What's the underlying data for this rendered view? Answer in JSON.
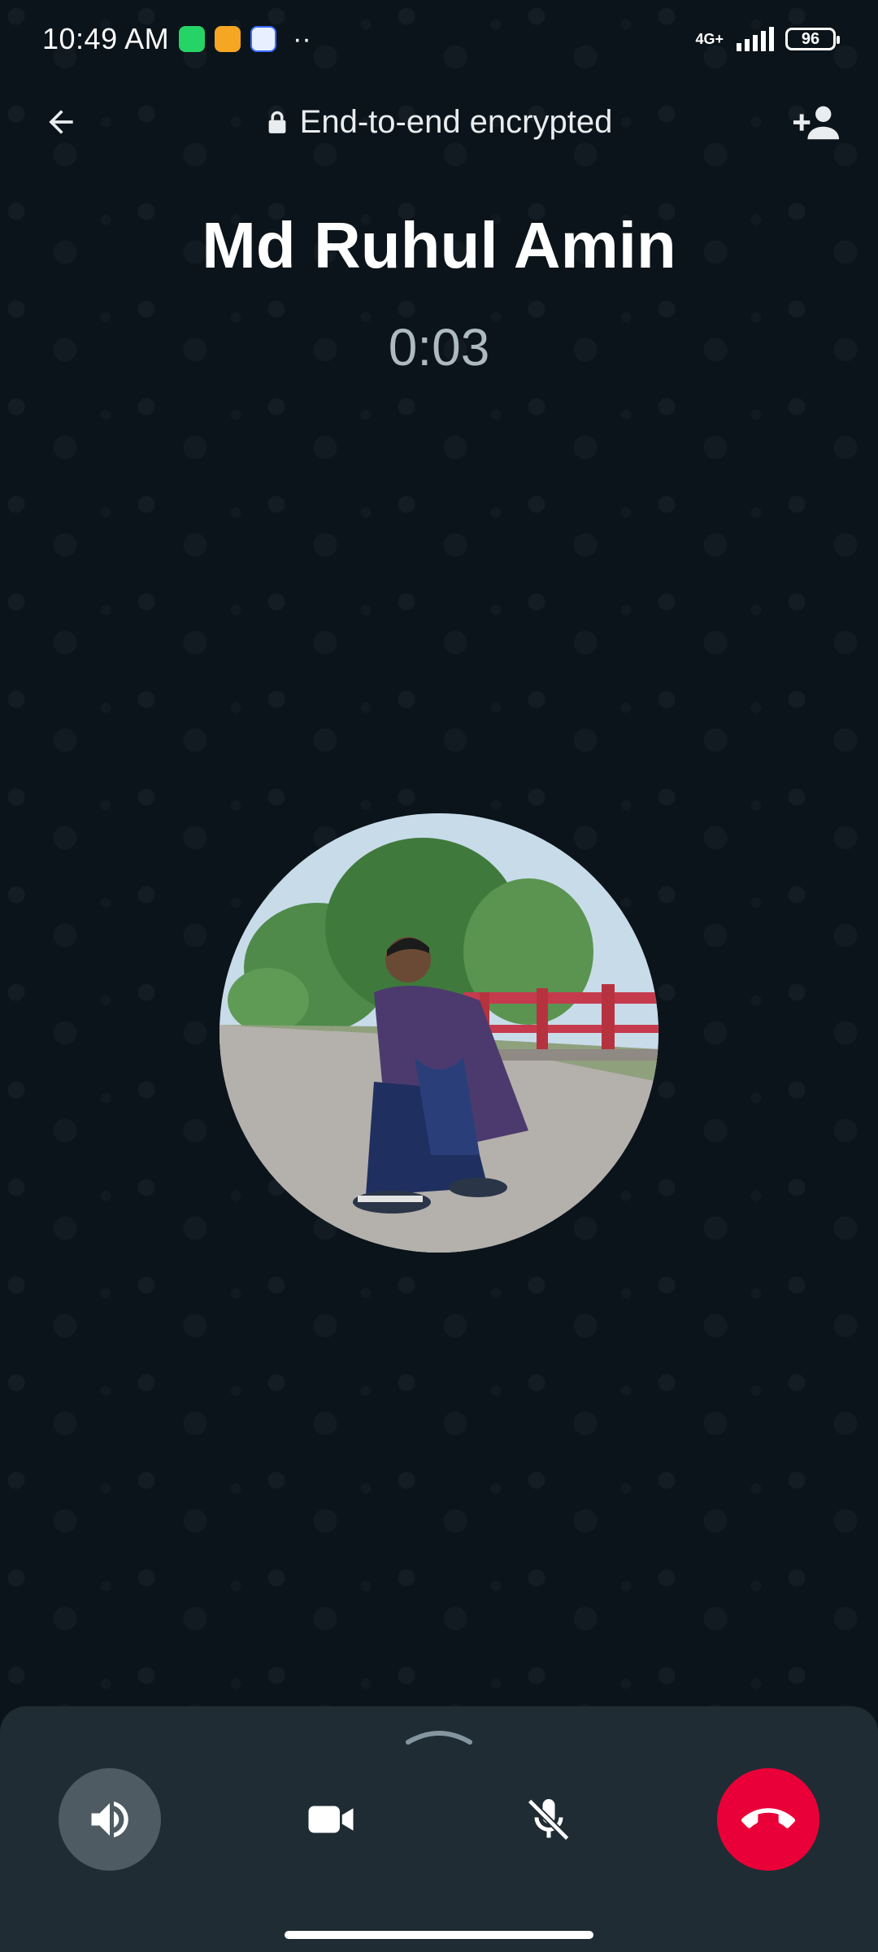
{
  "status_bar": {
    "time": "10:49 AM",
    "network": "4G+",
    "battery": "96",
    "notification_icons": [
      "whatsapp-icon",
      "notes-icon",
      "baidu-icon"
    ]
  },
  "header": {
    "encryption_text": "End-to-end encrypted",
    "back_icon": "arrow-left-icon",
    "add_participant_icon": "add-person-icon"
  },
  "call": {
    "contact_name": "Md Ruhul Amin",
    "duration": "0:03"
  },
  "controls": {
    "speaker": {
      "icon": "speaker-icon",
      "active": true
    },
    "video": {
      "icon": "video-camera-icon",
      "active": false
    },
    "mute": {
      "icon": "mic-off-icon",
      "active": false
    },
    "end_call": {
      "icon": "end-call-icon",
      "color": "#ea0038"
    }
  },
  "colors": {
    "background": "#0b141a",
    "panel": "#1f2c34",
    "end_call": "#ea0038",
    "speaker_active": "#4e5b62"
  }
}
